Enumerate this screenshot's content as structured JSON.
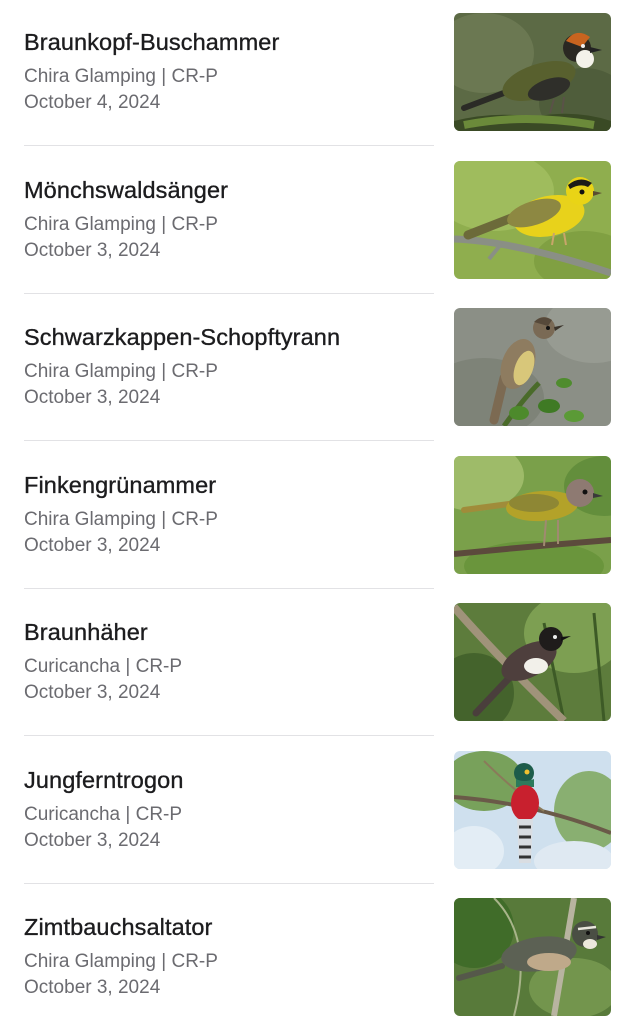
{
  "sightings": [
    {
      "name": "Braunkopf-Buschammer",
      "location": "Chira Glamping | CR-P",
      "date": "October 4, 2024",
      "photo_icon": "bird-photo-icon"
    },
    {
      "name": "Mönchswaldsänger",
      "location": "Chira Glamping | CR-P",
      "date": "October 3, 2024",
      "photo_icon": "bird-photo-icon"
    },
    {
      "name": "Schwarzkappen-Schopftyrann",
      "location": "Chira Glamping | CR-P",
      "date": "October 3, 2024",
      "photo_icon": "bird-photo-icon"
    },
    {
      "name": "Finkengrünammer",
      "location": "Chira Glamping | CR-P",
      "date": "October 3, 2024",
      "photo_icon": "bird-photo-icon"
    },
    {
      "name": "Braunhäher",
      "location": "Curicancha | CR-P",
      "date": "October 3, 2024",
      "photo_icon": "bird-photo-icon"
    },
    {
      "name": "Jungferntrogon",
      "location": "Curicancha | CR-P",
      "date": "October 3, 2024",
      "photo_icon": "bird-photo-icon"
    },
    {
      "name": "Zimtbauchsaltator",
      "location": "Chira Glamping | CR-P",
      "date": "October 3, 2024",
      "photo_icon": "bird-photo-icon"
    }
  ],
  "colors": {
    "title": "#1c1c1e",
    "secondary": "#6b6b70",
    "divider": "#e2e2e5"
  }
}
